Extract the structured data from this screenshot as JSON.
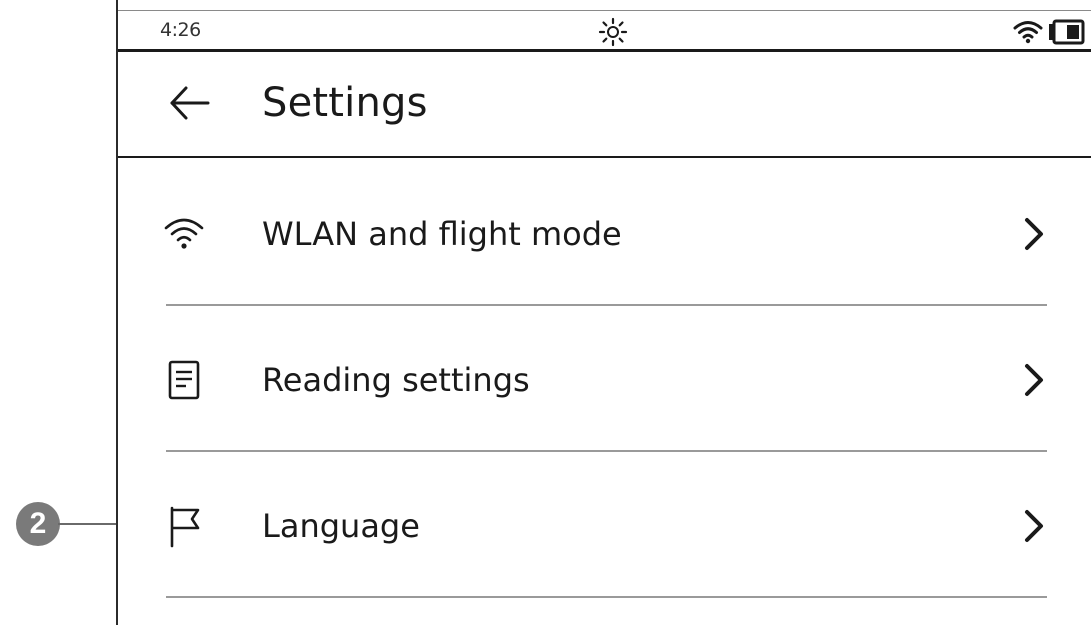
{
  "status_bar": {
    "time": "4:26",
    "center_icon": "brightness-icon",
    "right_icons": [
      "wifi-icon",
      "battery-icon"
    ]
  },
  "header": {
    "back_icon": "arrow-left-icon",
    "title": "Settings"
  },
  "settings_items": [
    {
      "label": "WLAN and flight mode",
      "icon": "wifi-icon",
      "chevron": "chevron-right-icon"
    },
    {
      "label": "Reading settings",
      "icon": "document-icon",
      "chevron": "chevron-right-icon"
    },
    {
      "label": "Language",
      "icon": "flag-icon",
      "chevron": "chevron-right-icon"
    }
  ],
  "annotation": {
    "callout_number": "2",
    "badge_color": "#7a7a7a"
  }
}
